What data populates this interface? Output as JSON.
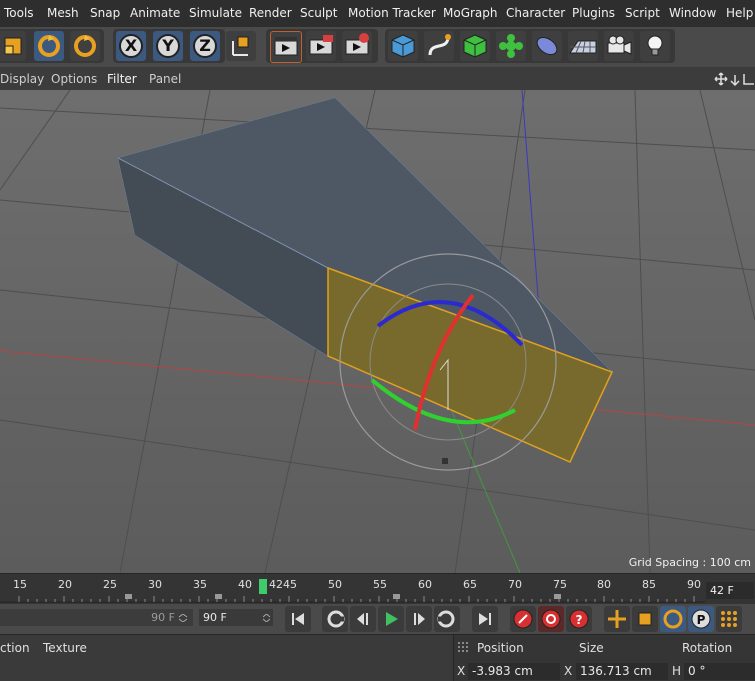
{
  "menu": [
    "Tools",
    "Mesh",
    "Snap",
    "Animate",
    "Simulate",
    "Render",
    "Sculpt",
    "Motion Tracker",
    "MoGraph",
    "Character",
    "Plugins",
    "Script",
    "Window",
    "Help"
  ],
  "axis_labels": {
    "x": "X",
    "y": "Y",
    "z": "Z"
  },
  "viewport_menu": [
    "Display",
    "Options",
    "Filter",
    "Panel"
  ],
  "grid_spacing": "Grid Spacing : 100 cm",
  "timeline": {
    "ticks": [
      "15",
      "20",
      "25",
      "30",
      "35",
      "40",
      "42",
      "45",
      "50",
      "55",
      "60",
      "65",
      "70",
      "75",
      "80",
      "85",
      "90"
    ],
    "current_frame": "42 F"
  },
  "transport": {
    "start_field": "90 F",
    "end_field": "90 F"
  },
  "bottom": {
    "tabs": [
      "ction",
      "Texture"
    ],
    "attr_headers": [
      "Position",
      "Size",
      "Rotation"
    ],
    "coords": {
      "x_label": "X",
      "x_pos": "-3.983 cm",
      "x2_label": "X",
      "x_size": "136.713 cm",
      "h_label": "H",
      "h_rot": "0 °"
    }
  }
}
